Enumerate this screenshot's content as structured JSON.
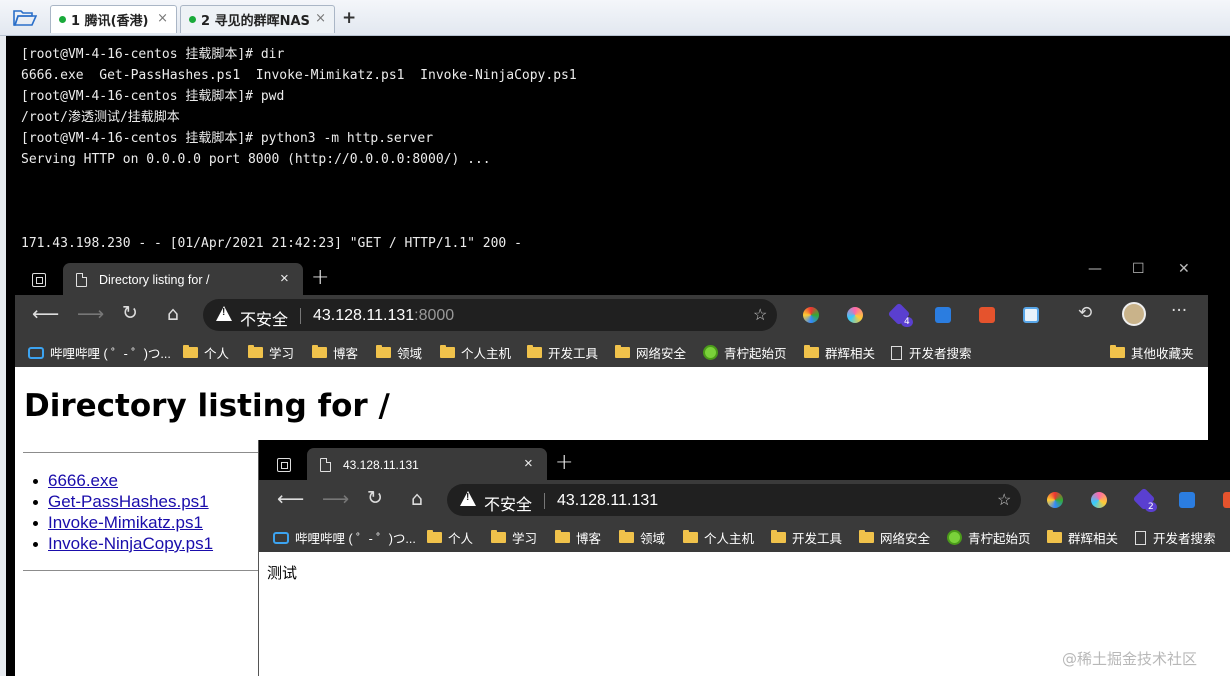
{
  "terminal_app": {
    "tabs": [
      {
        "label": "1 腾讯(香港)",
        "close": "×"
      },
      {
        "label": "2 寻见的群晖NAS",
        "close": "×"
      }
    ],
    "add_tab": "+",
    "lines": [
      "[root@VM-4-16-centos 挂载脚本]# dir",
      "6666.exe  Get-PassHashes.ps1  Invoke-Mimikatz.ps1  Invoke-NinjaCopy.ps1",
      "[root@VM-4-16-centos 挂载脚本]# pwd",
      "/root/渗透测试/挂载脚本",
      "[root@VM-4-16-centos 挂载脚本]# python3 -m http.server",
      "Serving HTTP on 0.0.0.0 port 8000 (http://0.0.0.0:8000/) ...",
      "171.43.198.230 - - [01/Apr/2021 21:42:23] \"GET / HTTP/1.1\" 200 -"
    ]
  },
  "browser1": {
    "tab_title": "Directory listing for /",
    "tab_close": "×",
    "new_tab": "+",
    "insecure_label": "不安全",
    "url_host": "43.128.11.131",
    "url_port": ":8000",
    "ext_badge": "4",
    "window_controls": {
      "minimize": "—",
      "maximize": "☐",
      "close": "✕"
    },
    "more": "···",
    "bookmarks": [
      "哔哩哔哩 ( ゜- ゜)つ...",
      "个人",
      "学习",
      "博客",
      "领域",
      "个人主机",
      "开发工具",
      "网络安全",
      "青柠起始页",
      "群辉相关",
      "开发者搜索"
    ],
    "other_bookmarks": "其他收藏夹",
    "page": {
      "heading": "Directory listing for /",
      "files": [
        "6666.exe",
        "Get-PassHashes.ps1",
        "Invoke-Mimikatz.ps1",
        "Invoke-NinjaCopy.ps1"
      ]
    }
  },
  "browser2": {
    "tab_title": "43.128.11.131",
    "tab_close": "×",
    "new_tab": "+",
    "insecure_label": "不安全",
    "url_host": "43.128.11.131",
    "ext_badge": "2",
    "bookmarks": [
      "哔哩哔哩 ( ゜- ゜)つ...",
      "个人",
      "学习",
      "博客",
      "领域",
      "个人主机",
      "开发工具",
      "网络安全",
      "青柠起始页",
      "群辉相关",
      "开发者搜索"
    ],
    "page_text": "测试"
  },
  "watermark": "@稀土掘金技术社区",
  "icons": [
    "folder-open-icon",
    "tab-actions-icon",
    "page-icon",
    "back-arrow-icon",
    "forward-arrow-icon",
    "refresh-icon",
    "home-icon",
    "warning-icon",
    "favorite-star-icon",
    "history-icon",
    "avatar-icon"
  ],
  "colors": {
    "terminal_bg": "#000000",
    "browser_chrome": "#3a3a3a",
    "link": "#1a0dab",
    "status_dot": "#1aaa3a"
  }
}
